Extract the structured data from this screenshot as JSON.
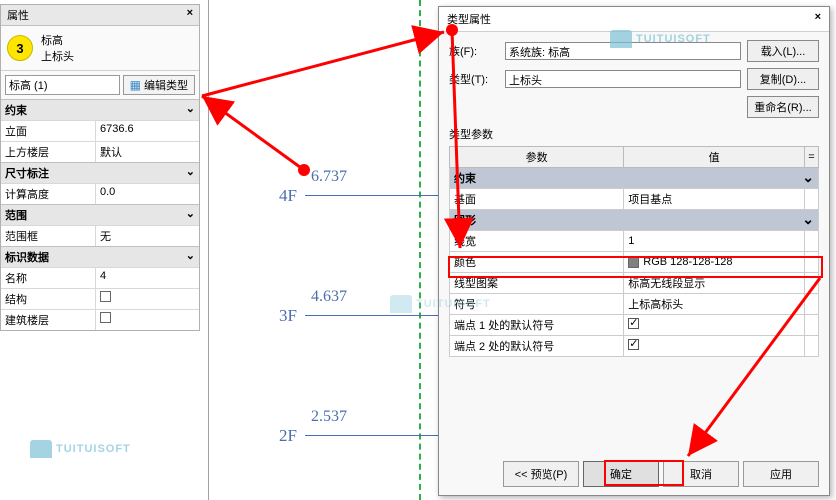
{
  "propPanel": {
    "title": "属性",
    "badge": "3",
    "headLine1": "标高",
    "headLine2": "上标头",
    "typeSelector": "标高 (1)",
    "editTypeBtn": "编辑类型",
    "groups": {
      "constraints": "约束",
      "dim": "尺寸标注",
      "extent": "范围",
      "iddata": "标识数据"
    },
    "rows": {
      "elevLabel": "立面",
      "elevVal": "6736.6",
      "aboveLabel": "上方楼层",
      "aboveVal": "默认",
      "compHLabel": "计算高度",
      "compHVal": "0.0",
      "scopeLabel": "范围框",
      "scopeVal": "无",
      "nameLabel": "名称",
      "nameVal": "4",
      "structLabel": "结构",
      "bstoryLabel": "建筑楼层"
    }
  },
  "canvas": {
    "levels": [
      {
        "name": "4F",
        "elev": "6.737"
      },
      {
        "name": "3F",
        "elev": "4.637"
      },
      {
        "name": "2F",
        "elev": "2.537"
      }
    ]
  },
  "dialog": {
    "title": "类型属性",
    "familyLabel": "族(F):",
    "familyVal": "系统族: 标高",
    "typeLabel": "类型(T):",
    "typeVal": "上标头",
    "loadBtn": "载入(L)...",
    "dupBtn": "复制(D)...",
    "renameBtn": "重命名(R)...",
    "typeParams": "类型参数",
    "thParam": "参数",
    "thValue": "值",
    "grpConstraints": "约束",
    "grpGraphics": "图形",
    "rows": {
      "baseLabel": "基面",
      "baseVal": "项目基点",
      "lwLabel": "线宽",
      "lwVal": "1",
      "colorLabel": "颜色",
      "colorVal": "RGB 128-128-128",
      "lpLabel": "线型图案",
      "lpVal": "标高无线段显示",
      "symLabel": "符号",
      "symVal": "上标高标头",
      "e1Label": "端点 1 处的默认符号",
      "e2Label": "端点 2 处的默认符号"
    },
    "previewBtn": "<< 预览(P)",
    "okBtn": "确定",
    "cancelBtn": "取消",
    "applyBtn": "应用"
  },
  "watermark": "TUITUISOFT"
}
